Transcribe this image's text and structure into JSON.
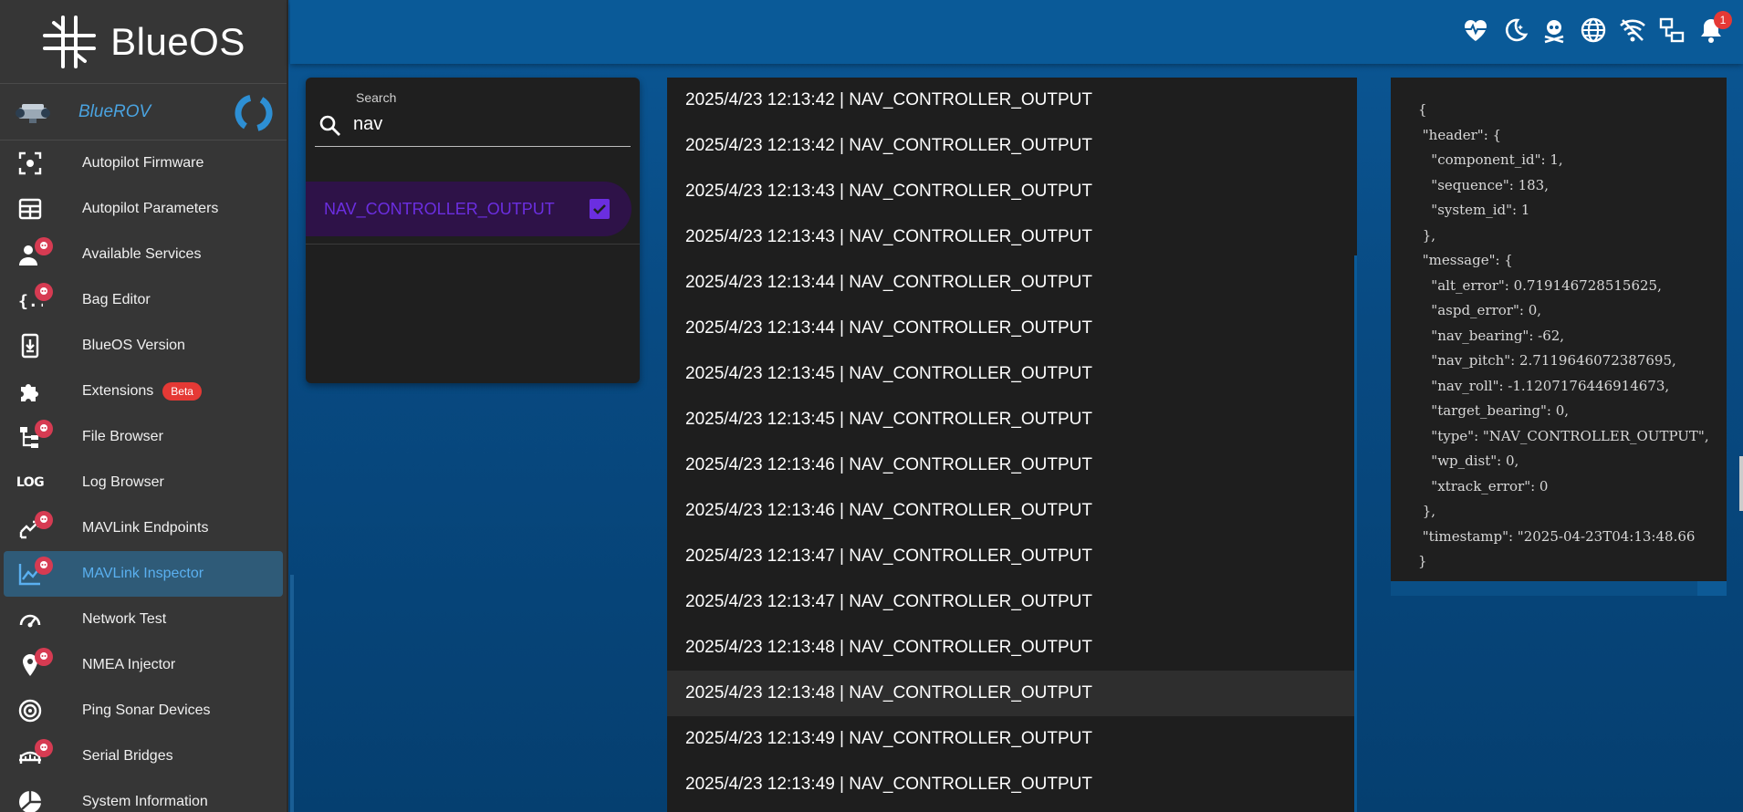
{
  "brand": {
    "name": "BlueOS"
  },
  "vehicle": {
    "name": "BlueROV"
  },
  "sidebar": {
    "items": [
      {
        "label": "Autopilot Firmware",
        "icon": "chip-icon"
      },
      {
        "label": "Autopilot Parameters",
        "icon": "table-icon"
      },
      {
        "label": "Available Services",
        "icon": "services-icon"
      },
      {
        "label": "Bag Editor",
        "icon": "code-braces-icon"
      },
      {
        "label": "BlueOS Version",
        "icon": "download-icon"
      },
      {
        "label": "Extensions",
        "icon": "puzzle-icon",
        "badge": "Beta"
      },
      {
        "label": "File Browser",
        "icon": "file-tree-icon"
      },
      {
        "label": "Log Browser",
        "icon": "log-icon",
        "icon_text": "LOG"
      },
      {
        "label": "MAVLink Endpoints",
        "icon": "arrows-icon"
      },
      {
        "label": "MAVLink Inspector",
        "icon": "chart-icon",
        "active": true
      },
      {
        "label": "Network Test",
        "icon": "speedometer-icon"
      },
      {
        "label": "NMEA Injector",
        "icon": "map-marker-icon"
      },
      {
        "label": "Ping Sonar Devices",
        "icon": "sonar-icon"
      },
      {
        "label": "Serial Bridges",
        "icon": "bridge-icon"
      },
      {
        "label": "System Information",
        "icon": "pie-chart-icon"
      }
    ]
  },
  "topbar": {
    "icons": [
      "heart-pulse-icon",
      "night-mode-icon",
      "pirate-mode-icon",
      "globe-icon",
      "wifi-off-icon",
      "network-icon",
      "bell-icon"
    ],
    "notification_count": "1"
  },
  "search": {
    "label": "Search",
    "value": "nav",
    "result": "NAV_CONTROLLER_OUTPUT",
    "result_checked": true
  },
  "messages": [
    "2025/4/23 12:13:42 | NAV_CONTROLLER_OUTPUT",
    "2025/4/23 12:13:42 | NAV_CONTROLLER_OUTPUT",
    "2025/4/23 12:13:43 | NAV_CONTROLLER_OUTPUT",
    "2025/4/23 12:13:43 | NAV_CONTROLLER_OUTPUT",
    "2025/4/23 12:13:44 | NAV_CONTROLLER_OUTPUT",
    "2025/4/23 12:13:44 | NAV_CONTROLLER_OUTPUT",
    "2025/4/23 12:13:45 | NAV_CONTROLLER_OUTPUT",
    "2025/4/23 12:13:45 | NAV_CONTROLLER_OUTPUT",
    "2025/4/23 12:13:46 | NAV_CONTROLLER_OUTPUT",
    "2025/4/23 12:13:46 | NAV_CONTROLLER_OUTPUT",
    "2025/4/23 12:13:47 | NAV_CONTROLLER_OUTPUT",
    "2025/4/23 12:13:47 | NAV_CONTROLLER_OUTPUT",
    "2025/4/23 12:13:48 | NAV_CONTROLLER_OUTPUT",
    "2025/4/23 12:13:48 | NAV_CONTROLLER_OUTPUT",
    "2025/4/23 12:13:49 | NAV_CONTROLLER_OUTPUT",
    "2025/4/23 12:13:49 | NAV_CONTROLLER_OUTPUT"
  ],
  "selected_message_index": 13,
  "json_lines": [
    "{",
    " \"header\": {",
    "   \"component_id\": 1,",
    "   \"sequence\": 183,",
    "   \"system_id\": 1",
    " },",
    " \"message\": {",
    "   \"alt_error\": 0.719146728515625,",
    "   \"aspd_error\": 0,",
    "   \"nav_bearing\": -62,",
    "   \"nav_pitch\": 2.7119646072387695,",
    "   \"nav_roll\": -1.1207176446914673,",
    "   \"target_bearing\": 0,",
    "   \"type\": \"NAV_CONTROLLER_OUTPUT\",",
    "   \"wp_dist\": 0,",
    "   \"xtrack_error\": 0",
    " },",
    " \"timestamp\": \"2025-04-23T04:13:48.66",
    "}"
  ],
  "colors": {
    "accent": "#6b2ee0",
    "active_nav": "#2f5b78",
    "badge": "#e53935",
    "topbar": "#0a5a98"
  }
}
